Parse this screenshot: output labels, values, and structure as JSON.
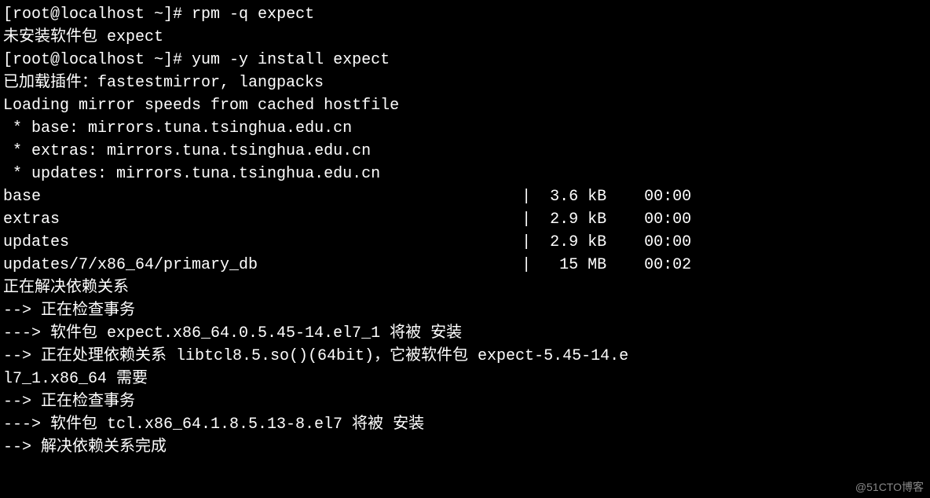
{
  "prompt1": "[root@localhost ~]# ",
  "cmd1": "rpm -q expect",
  "out1": "未安装软件包 expect",
  "prompt2": "[root@localhost ~]# ",
  "cmd2": "yum -y install expect",
  "plugins": "已加载插件：fastestmirror, langpacks",
  "loading": "Loading mirror speeds from cached hostfile",
  "mirror_base": " * base: mirrors.tuna.tsinghua.edu.cn",
  "mirror_extras": " * extras: mirrors.tuna.tsinghua.edu.cn",
  "mirror_updates": " * updates: mirrors.tuna.tsinghua.edu.cn",
  "repos": [
    {
      "name": "base",
      "size": "3.6 kB",
      "time": "00:00"
    },
    {
      "name": "extras",
      "size": "2.9 kB",
      "time": "00:00"
    },
    {
      "name": "updates",
      "size": "2.9 kB",
      "time": "00:00"
    },
    {
      "name": "updates/7/x86_64/primary_db",
      "size": " 15 MB",
      "time": "00:02"
    }
  ],
  "resolving": "正在解决依赖关系",
  "trans1": "--> 正在检查事务",
  "pkg1": "---> 软件包 expect.x86_64.0.5.45-14.el7_1 将被 安装",
  "dep1a": "--> 正在处理依赖关系 libtcl8.5.so()(64bit)，它被软件包 expect-5.45-14.e",
  "dep1b": "l7_1.x86_64 需要",
  "trans2": "--> 正在检查事务",
  "pkg2": "---> 软件包 tcl.x86_64.1.8.5.13-8.el7 将被 安装",
  "done": "--> 解决依赖关系完成",
  "watermark": "@51CTO博客"
}
